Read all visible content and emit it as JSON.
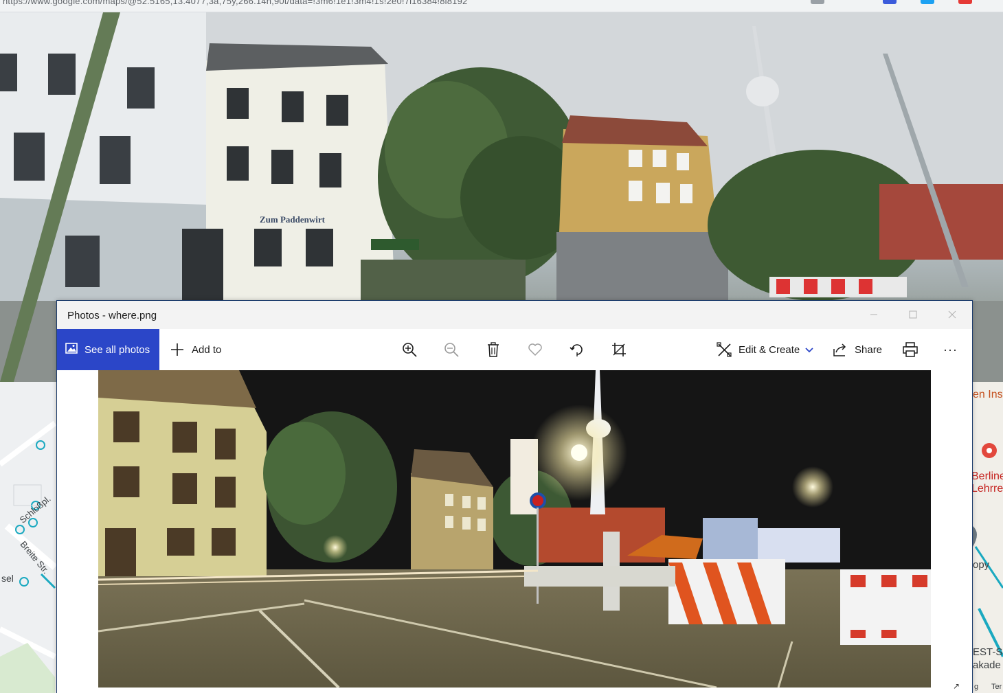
{
  "browser": {
    "url_fragment": "https://www.google.com/maps/@52.5165,13.4077,3a,75y,266.14h,90t/data=!3m6!1e1!3m4!1s!2e0!7i16384!8i8192"
  },
  "map": {
    "labels": [
      "Schloßpl.",
      "Breite Str.",
      "sel",
      "en Ins",
      "Berline",
      "Lehrre",
      "opy",
      "EST-S",
      "akade",
      "g",
      "Ter"
    ]
  },
  "photos_window": {
    "title": "Photos - where.png",
    "window_controls": {
      "minimize_icon": "minimize-icon",
      "maximize_icon": "maximize-icon",
      "close_icon": "close-icon"
    },
    "toolbar": {
      "see_all_label": "See all photos",
      "add_to_label": "Add to",
      "edit_create_label": "Edit & Create",
      "share_label": "Share",
      "more_glyph": "···"
    }
  },
  "colors": {
    "accent": "#2b46c8",
    "title_bar": "#f3f3f3",
    "window_border": "#1a3a6b"
  }
}
